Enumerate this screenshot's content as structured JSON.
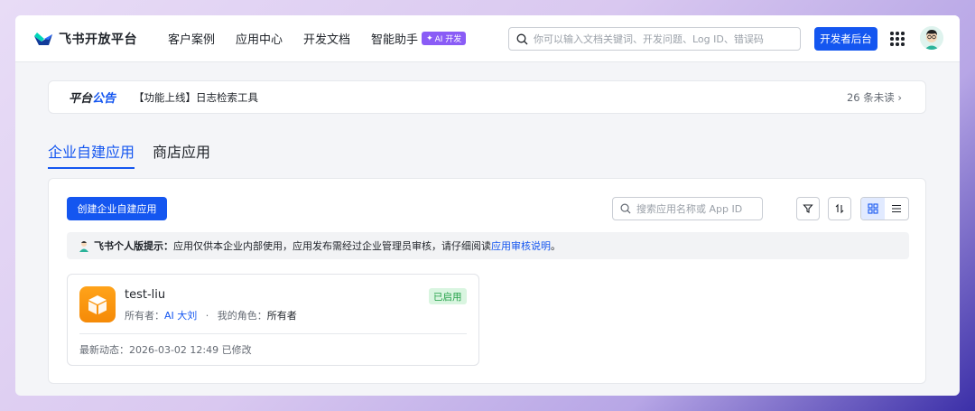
{
  "nav": {
    "brand": "飞书开放平台",
    "items": [
      "客户案例",
      "应用中心",
      "开发文档",
      "智能助手"
    ],
    "ai_badge": "AI 开发",
    "search_placeholder": "你可以输入文档关键词、开发问题、Log ID、错误码",
    "dev_console": "开发者后台"
  },
  "announcement": {
    "title_prefix": "平台",
    "title_highlight": "公告",
    "text": "【功能上线】日志检索工具",
    "unread": "26 条未读"
  },
  "tabs": [
    {
      "label": "企业自建应用",
      "active": true
    },
    {
      "label": "商店应用",
      "active": false
    }
  ],
  "toolbar": {
    "create_label": "创建企业自建应用",
    "search_placeholder": "搜索应用名称或 App ID"
  },
  "notice": {
    "lead": "飞书个人版提示：",
    "text": "应用仅供本企业内部使用，应用发布需经过企业管理员审核，请仔细阅读 ",
    "link": "应用审核说明",
    "tail": "。"
  },
  "app": {
    "name": "test-liu",
    "owner_label": "所有者：",
    "owner": "AI 大刘",
    "sep": "·",
    "role_label": "我的角色：",
    "role": "所有者",
    "status": "已启用",
    "updated": "最新动态：2026-03-02 12:49 已修改"
  },
  "colors": {
    "primary": "#1456f0",
    "app_icon": "#f58a07",
    "status_green": "#24a148",
    "ai_purple": "#8a5cf6"
  }
}
